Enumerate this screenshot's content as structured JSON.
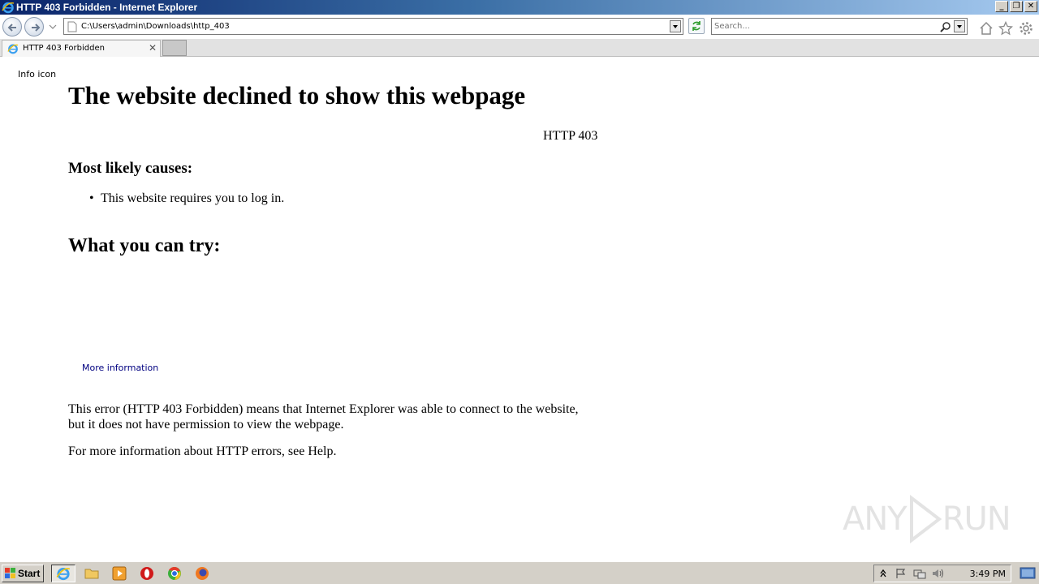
{
  "window": {
    "title": "HTTP 403 Forbidden - Internet Explorer",
    "minimize": "_",
    "maximize": "❐",
    "close": "✕"
  },
  "address": {
    "url": "C:\\Users\\admin\\Downloads\\http_403"
  },
  "search": {
    "placeholder": "Search..."
  },
  "tabs": [
    {
      "label": "HTTP 403 Forbidden",
      "close": "✕"
    }
  ],
  "page": {
    "info_icon_alt": "Info icon",
    "title": "The website declined to show this webpage",
    "http_code": "HTTP 403",
    "causes_heading": "Most likely causes:",
    "causes": [
      {
        "bullet": "•",
        "text": "This website requires you to log in."
      }
    ],
    "try_heading": "What you can try:",
    "more_info": "More information",
    "error_description": "This error (HTTP 403 Forbidden) means that Internet Explorer was able to connect to the website, but it does not have permission to view the webpage.",
    "help_text": "For more information about HTTP errors, see Help."
  },
  "watermark": {
    "left": "ANY",
    "right": "RUN"
  },
  "taskbar": {
    "start_label": "Start",
    "clock": "3:49 PM"
  },
  "colors": {
    "link": "#000080",
    "titlebar_start": "#0a246a",
    "titlebar_end": "#a6caf0",
    "taskbar": "#d4d0c8"
  }
}
